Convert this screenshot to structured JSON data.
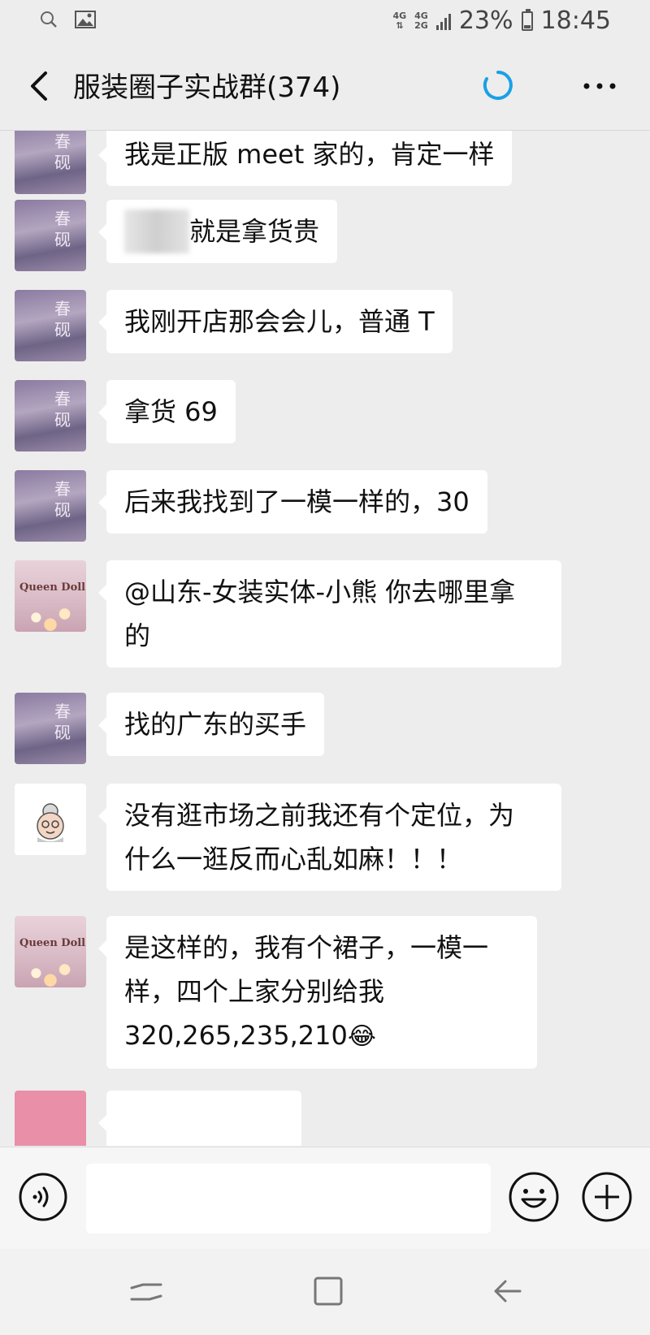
{
  "status_bar": {
    "network_1": "4G",
    "network_2_top": "4G",
    "network_2_bottom": "2G",
    "battery": "23%",
    "time": "18:45",
    "battery_level": 0.23
  },
  "header": {
    "title": "服装圈子实战群(374)",
    "spinner_color": "#1aa0e6"
  },
  "avatars": {
    "chunyan": "春\n砚",
    "queen_doll": "Queen Doll"
  },
  "messages": [
    {
      "avatar": "chunyan",
      "text": "我是正版 meet 家的，肯定一样"
    },
    {
      "avatar": "chunyan",
      "text": "就是拿货贵",
      "blurred_prefix": true
    },
    {
      "avatar": "chunyan",
      "text": "我刚开店那会会儿，普通 T"
    },
    {
      "avatar": "chunyan",
      "text": "拿货 69"
    },
    {
      "avatar": "chunyan",
      "text": "后来我找到了一模一样的，30"
    },
    {
      "avatar": "queen_doll",
      "line1": "@山东-女装实体-小熊  你去哪里拿",
      "line2": "的"
    },
    {
      "avatar": "chunyan",
      "text": "找的广东的买手"
    },
    {
      "avatar": "grandma",
      "line1": "没有逛市场之前我还有个定位，为",
      "line2": "什么一逛反而心乱如麻！！！"
    },
    {
      "avatar": "queen_doll",
      "line1": "是这样的，我有个裙子，一模一",
      "line2": "样，四个上家分别给我",
      "line3": "320,265,235,210",
      "emoji": "😂"
    }
  ],
  "input_bar": {
    "placeholder": ""
  },
  "colors": {
    "background": "#ededed",
    "bubble": "#ffffff"
  }
}
